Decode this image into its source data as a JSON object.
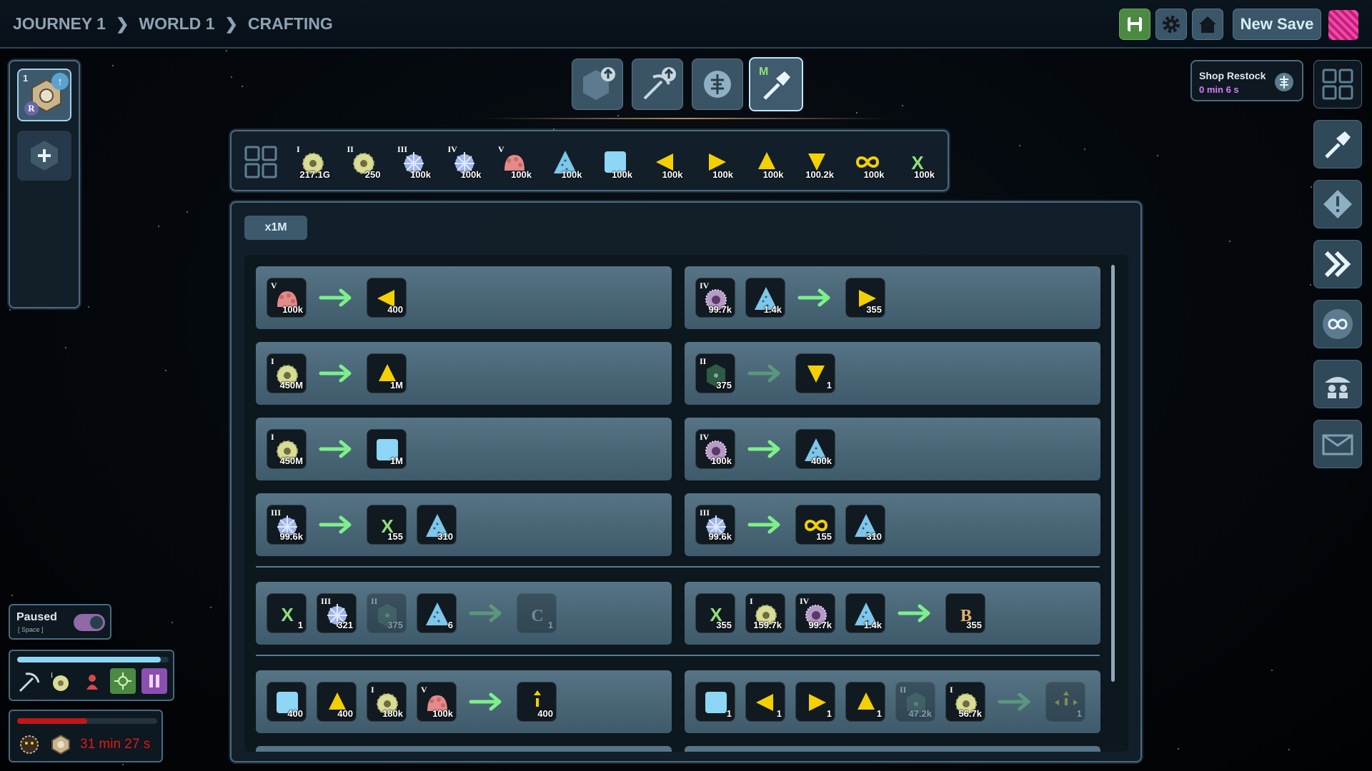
{
  "breadcrumb": {
    "items": [
      "JOURNEY 1",
      "WORLD 1",
      "CRAFTING"
    ]
  },
  "topbar": {
    "new_save_label": "New Save"
  },
  "left_panel": {
    "slot_number": "1",
    "slot_badge": "R"
  },
  "shop": {
    "title": "Shop Restock",
    "timer": "0 min 6 s"
  },
  "mode_tabs": {
    "active_tab_letter": "M"
  },
  "resource_bar": [
    {
      "icon": "gear-disc",
      "rank": "I",
      "count": "217.1G",
      "color": "#d9dc95"
    },
    {
      "icon": "gear-disc",
      "rank": "II",
      "count": "250",
      "color": "#2f5a48"
    },
    {
      "icon": "crystal-burst",
      "rank": "III",
      "count": "100k",
      "color": "#9fb4e8"
    },
    {
      "icon": "crystal-burst",
      "rank": "IV",
      "count": "100k",
      "color": "#b89ac8"
    },
    {
      "icon": "coral-blob",
      "rank": "V",
      "count": "100k",
      "color": "#e48a8a"
    },
    {
      "icon": "triangle-dotted",
      "rank": "",
      "count": "100k",
      "color": "#7cc7ea"
    },
    {
      "icon": "square-rounded",
      "rank": "",
      "count": "100k",
      "color": "#8ed6f5"
    },
    {
      "icon": "triangle-left",
      "rank": "",
      "count": "100k",
      "color": "#f4d000"
    },
    {
      "icon": "triangle-right",
      "rank": "",
      "count": "100k",
      "color": "#f4d000"
    },
    {
      "icon": "triangle-up",
      "rank": "",
      "count": "100k",
      "color": "#f4d000"
    },
    {
      "icon": "triangle-down",
      "rank": "",
      "count": "100.2k",
      "color": "#f4d000"
    },
    {
      "icon": "infinity",
      "rank": "",
      "count": "100k",
      "color": "#f4d000"
    },
    {
      "icon": "x-letter",
      "rank": "",
      "count": "100k",
      "color": "#8fe07a"
    }
  ],
  "multiplier_label": "x1M",
  "recipes": [
    {
      "inputs": [
        {
          "icon": "coral-blob",
          "rank": "V",
          "count": "100k"
        }
      ],
      "outputs": [
        {
          "icon": "triangle-left",
          "rank": "",
          "count": "400"
        }
      ],
      "active": true
    },
    {
      "inputs": [
        {
          "icon": "crystal-burst-iv",
          "rank": "IV",
          "count": "99.7k"
        },
        {
          "icon": "triangle-dotted",
          "rank": "",
          "count": "1.4k"
        }
      ],
      "outputs": [
        {
          "icon": "triangle-right",
          "rank": "",
          "count": "355"
        }
      ],
      "active": true
    },
    {
      "inputs": [
        {
          "icon": "gear-disc",
          "rank": "I",
          "count": "450M"
        }
      ],
      "outputs": [
        {
          "icon": "triangle-up",
          "rank": "",
          "count": "1M"
        }
      ],
      "active": true
    },
    {
      "inputs": [
        {
          "icon": "gear-disc-ii",
          "rank": "II",
          "count": "375"
        }
      ],
      "outputs": [
        {
          "icon": "triangle-down",
          "rank": "",
          "count": "1"
        }
      ],
      "active": false
    },
    {
      "inputs": [
        {
          "icon": "gear-disc",
          "rank": "I",
          "count": "450M"
        }
      ],
      "outputs": [
        {
          "icon": "square-rounded",
          "rank": "",
          "count": "1M"
        }
      ],
      "active": true
    },
    {
      "inputs": [
        {
          "icon": "crystal-burst-iv",
          "rank": "IV",
          "count": "100k"
        }
      ],
      "outputs": [
        {
          "icon": "triangle-dotted",
          "rank": "",
          "count": "400k"
        }
      ],
      "active": true
    },
    {
      "inputs": [
        {
          "icon": "crystal-burst",
          "rank": "III",
          "count": "99.6k"
        }
      ],
      "outputs": [
        {
          "icon": "x-letter",
          "rank": "",
          "count": "155"
        },
        {
          "icon": "triangle-dotted",
          "rank": "",
          "count": "310"
        }
      ],
      "active": true
    },
    {
      "inputs": [
        {
          "icon": "crystal-burst",
          "rank": "III",
          "count": "99.6k"
        }
      ],
      "outputs": [
        {
          "icon": "infinity",
          "rank": "",
          "count": "155"
        },
        {
          "icon": "triangle-dotted",
          "rank": "",
          "count": "310"
        }
      ],
      "active": true
    },
    {
      "inputs": [
        {
          "icon": "x-letter",
          "rank": "",
          "count": "1"
        },
        {
          "icon": "crystal-burst",
          "rank": "III",
          "count": "321"
        },
        {
          "icon": "gear-disc-ii",
          "rank": "II",
          "count": "375",
          "dim": true
        },
        {
          "icon": "triangle-dotted",
          "rank": "",
          "count": "6"
        }
      ],
      "outputs": [
        {
          "icon": "letter-c",
          "rank": "",
          "count": "1",
          "dim": true
        }
      ],
      "active": false
    },
    {
      "inputs": [
        {
          "icon": "x-letter",
          "rank": "",
          "count": "355"
        },
        {
          "icon": "gear-disc",
          "rank": "I",
          "count": "159.7k"
        },
        {
          "icon": "crystal-burst-iv",
          "rank": "IV",
          "count": "99.7k"
        },
        {
          "icon": "triangle-dotted",
          "rank": "",
          "count": "1.4k"
        }
      ],
      "outputs": [
        {
          "icon": "letter-b",
          "rank": "",
          "count": "355"
        }
      ],
      "active": true
    },
    {
      "inputs": [
        {
          "icon": "square-rounded",
          "rank": "",
          "count": "400"
        },
        {
          "icon": "triangle-up",
          "rank": "",
          "count": "400"
        },
        {
          "icon": "gear-disc",
          "rank": "I",
          "count": "180k"
        },
        {
          "icon": "coral-blob",
          "rank": "V",
          "count": "100k"
        }
      ],
      "outputs": [
        {
          "icon": "exclaim-up",
          "rank": "",
          "count": "400"
        }
      ],
      "active": true
    },
    {
      "inputs": [
        {
          "icon": "square-rounded",
          "rank": "",
          "count": "1"
        },
        {
          "icon": "triangle-left",
          "rank": "",
          "count": "1"
        },
        {
          "icon": "triangle-right",
          "rank": "",
          "count": "1"
        },
        {
          "icon": "triangle-up",
          "rank": "",
          "count": "1"
        },
        {
          "icon": "gear-disc-ii",
          "rank": "II",
          "count": "47.2k",
          "dim": true
        },
        {
          "icon": "gear-disc",
          "rank": "I",
          "count": "56.7k"
        }
      ],
      "outputs": [
        {
          "icon": "compass-arrows",
          "rank": "",
          "count": "1",
          "dim": true
        }
      ],
      "active": false
    }
  ],
  "status": {
    "paused_label": "Paused",
    "paused_hint": "[ Space ]",
    "timer": "31 min 27 s",
    "progress_blue": 0.95,
    "progress_red": 0.5
  },
  "colors": {
    "arrow_green": "#7df08a",
    "accent": "#4a6a80",
    "timer_red": "#e01818",
    "shop_timer": "#d97cff"
  }
}
